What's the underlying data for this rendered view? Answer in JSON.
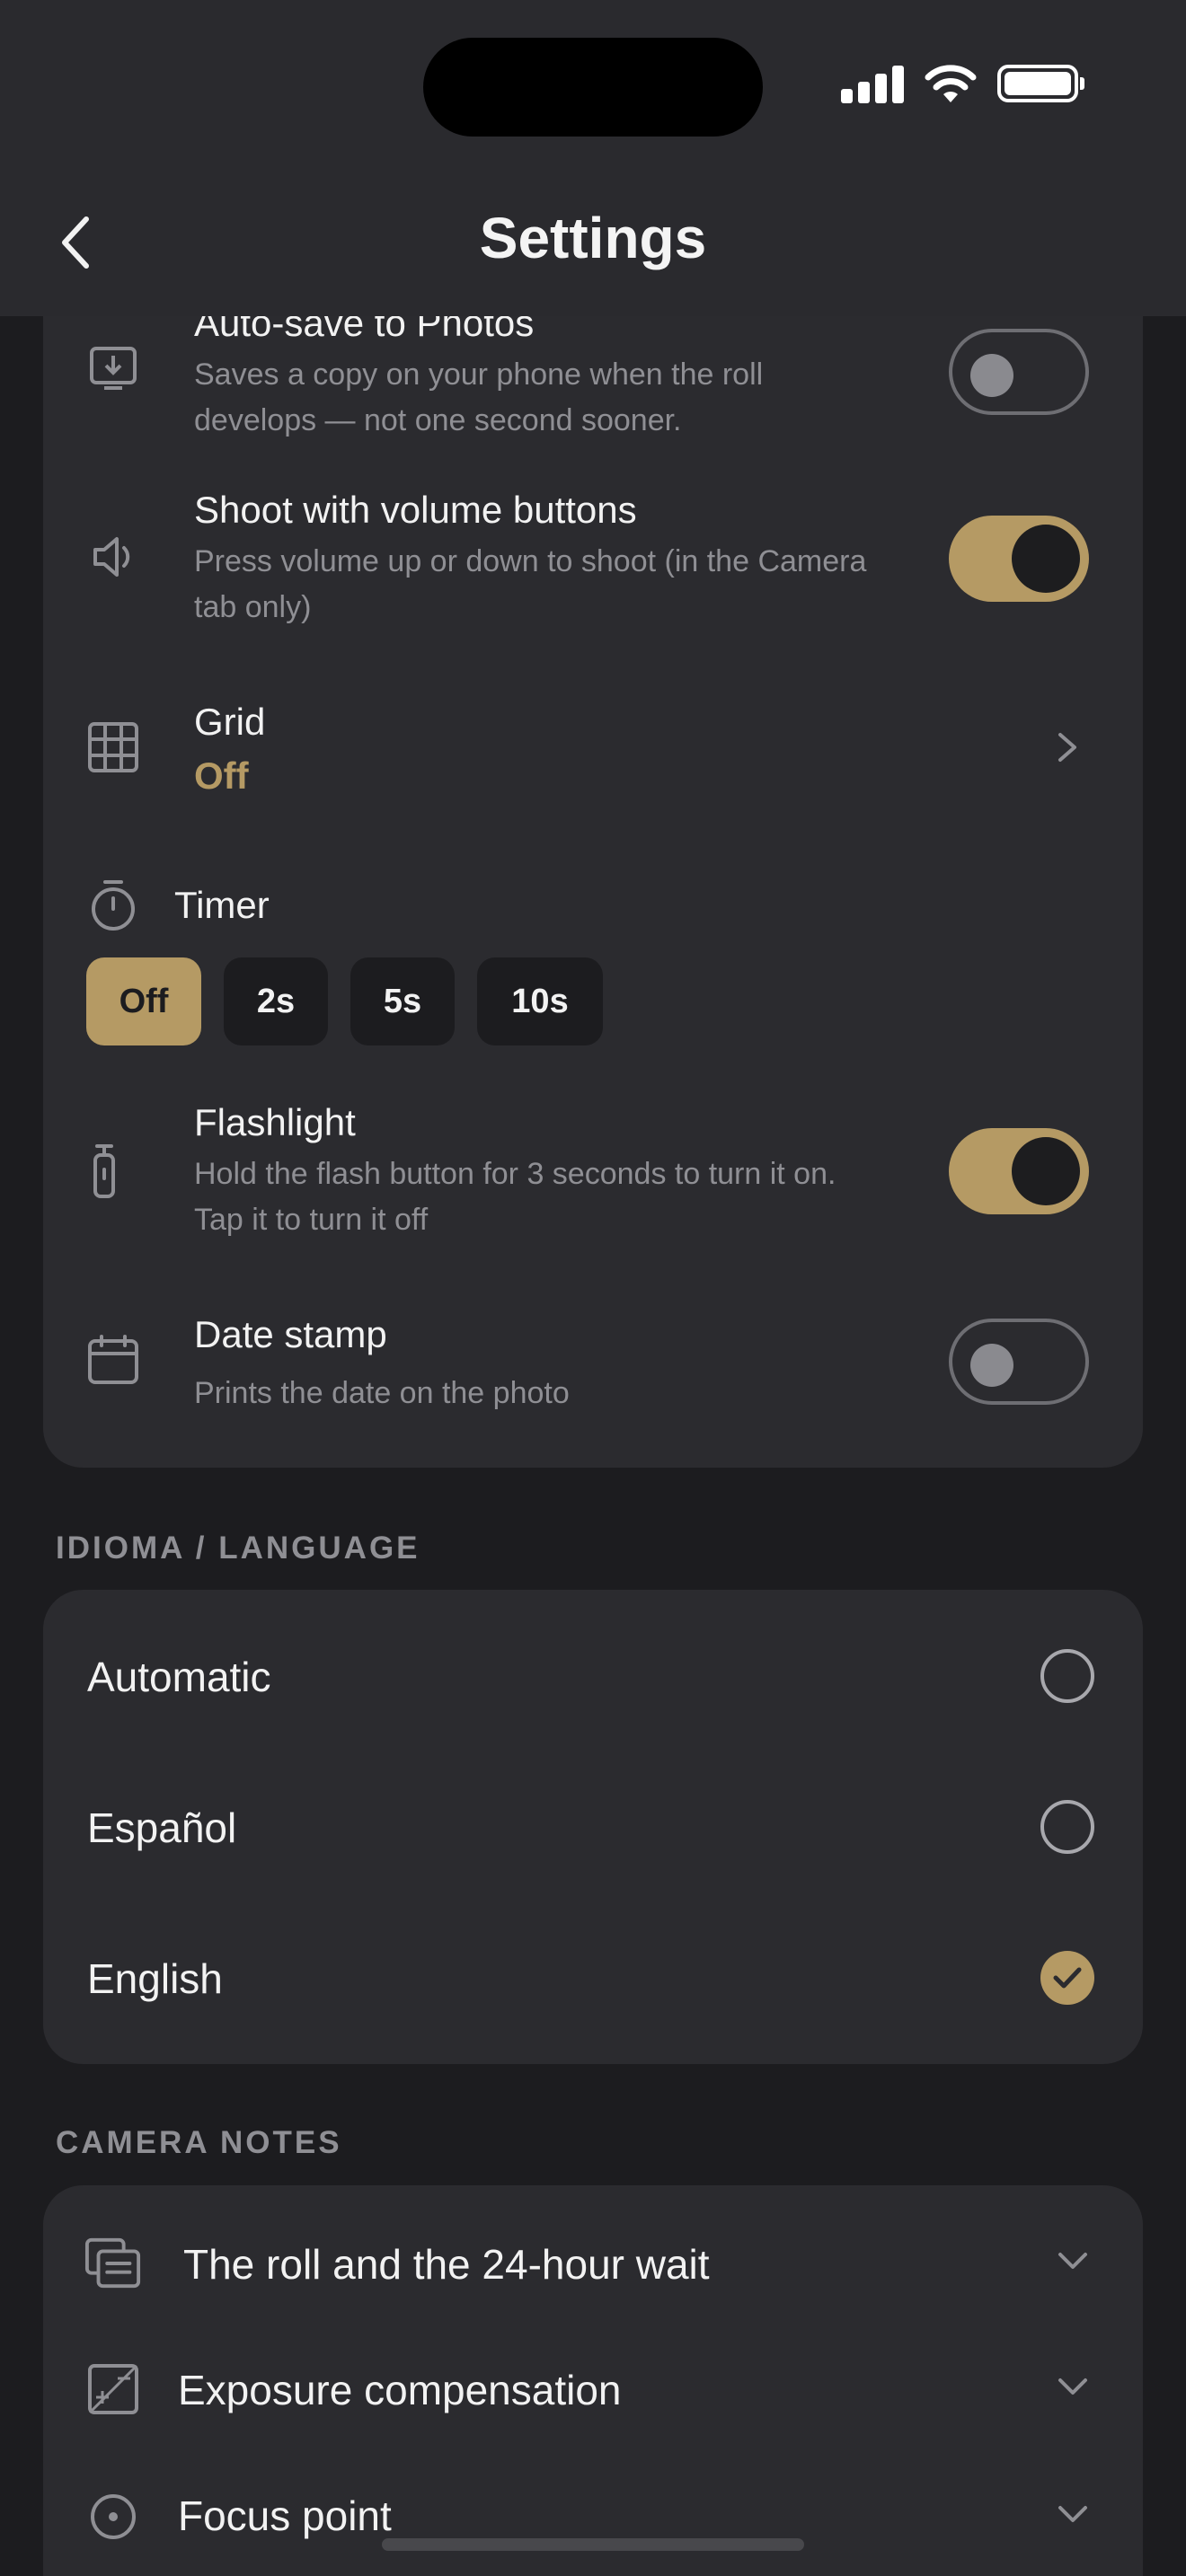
{
  "header": {
    "title": "Settings",
    "back_icon": "chevron-left-icon"
  },
  "status_bar": {
    "signal": "signal-icon",
    "wifi": "wifi-icon",
    "battery": "battery-icon"
  },
  "camera_settings": {
    "auto_save": {
      "title": "Auto-save to Photos",
      "subtitle": "Saves a copy on your phone when the roll develops — not one second sooner.",
      "icon": "download-icon",
      "enabled": false
    },
    "volume_buttons": {
      "title": "Shoot with volume buttons",
      "subtitle": "Press volume up or down to shoot (in the Camera tab only)",
      "icon": "speaker-icon",
      "enabled": true
    },
    "grid": {
      "title": "Grid",
      "value": "Off",
      "icon": "grid-icon"
    },
    "timer": {
      "title": "Timer",
      "icon": "timer-icon",
      "options": [
        "Off",
        "2s",
        "5s",
        "10s"
      ],
      "selected": "Off"
    },
    "flashlight": {
      "title": "Flashlight",
      "subtitle": "Hold the flash button for 3 seconds to turn it on. Tap it to turn it off",
      "icon": "flashlight-icon",
      "enabled": true
    },
    "date_stamp": {
      "title": "Date stamp",
      "subtitle": "Prints the date on the photo",
      "icon": "calendar-icon",
      "enabled": false
    }
  },
  "language": {
    "section_label": "IDIOMA / LANGUAGE",
    "options": [
      "Automatic",
      "Español",
      "English"
    ],
    "selected": "English"
  },
  "camera_notes": {
    "section_label": "CAMERA NOTES",
    "items": [
      {
        "label": "The roll and the 24-hour wait",
        "icon": "cards-icon"
      },
      {
        "label": "Exposure compensation",
        "icon": "exposure-icon"
      },
      {
        "label": "Focus point",
        "icon": "focus-icon"
      }
    ]
  },
  "colors": {
    "accent": "#b59a64",
    "background": "#1c1c1f",
    "card": "#2b2b2f",
    "header": "#2a2a2e"
  }
}
